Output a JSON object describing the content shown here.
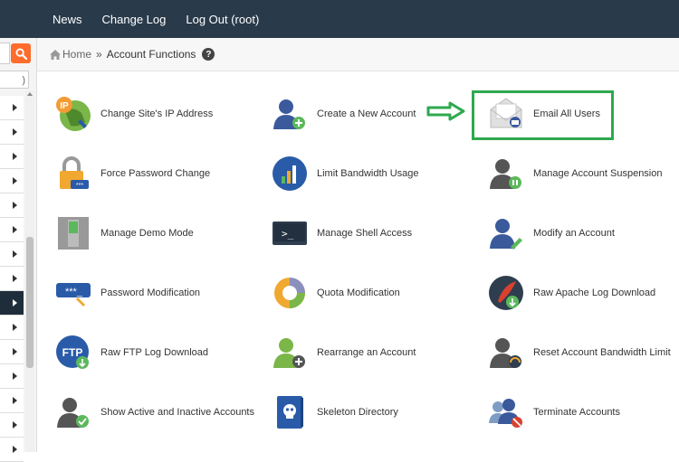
{
  "topnav": {
    "items": [
      "News",
      "Change Log",
      "Log Out (root)"
    ]
  },
  "breadcrumb": {
    "home": "Home",
    "separator": "»",
    "current": "Account Functions",
    "help": "?"
  },
  "colors": {
    "topbar": "#293a4a",
    "accent_orange": "#ff6c2c",
    "highlight_green": "#2fa84f"
  },
  "functions": [
    {
      "label": "Change Site's IP Address",
      "icon": "ip-globe-icon"
    },
    {
      "label": "Create a New Account",
      "icon": "user-add-icon"
    },
    {
      "label": "Email All Users",
      "icon": "envelope-icon"
    },
    {
      "label": "Force Password Change",
      "icon": "padlock-icon"
    },
    {
      "label": "Limit Bandwidth Usage",
      "icon": "bandwidth-chart-icon"
    },
    {
      "label": "Manage Account Suspension",
      "icon": "user-suspend-icon"
    },
    {
      "label": "Manage Demo Mode",
      "icon": "demo-switch-icon"
    },
    {
      "label": "Manage Shell Access",
      "icon": "terminal-icon"
    },
    {
      "label": "Modify an Account",
      "icon": "user-edit-icon"
    },
    {
      "label": "Password Modification",
      "icon": "password-key-icon"
    },
    {
      "label": "Quota Modification",
      "icon": "quota-pie-icon"
    },
    {
      "label": "Raw Apache Log Download",
      "icon": "apache-feather-icon"
    },
    {
      "label": "Raw FTP Log Download",
      "icon": "ftp-download-icon"
    },
    {
      "label": "Rearrange an Account",
      "icon": "user-move-icon"
    },
    {
      "label": "Reset Account Bandwidth Limit",
      "icon": "user-gauge-icon"
    },
    {
      "label": "Show Active and Inactive Accounts",
      "icon": "user-check-icon"
    },
    {
      "label": "Skeleton Directory",
      "icon": "skeleton-book-icon"
    },
    {
      "label": "Terminate Accounts",
      "icon": "users-remove-icon"
    }
  ]
}
